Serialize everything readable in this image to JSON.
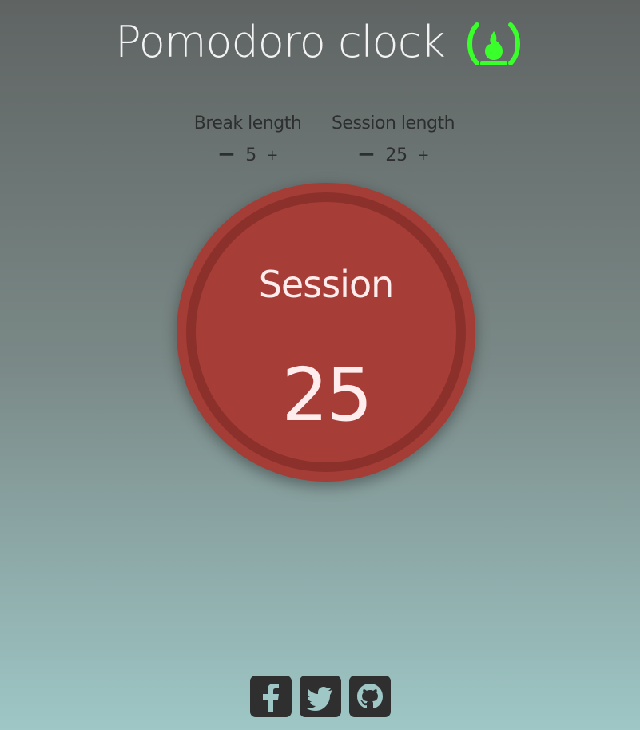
{
  "title": {
    "text": "Pomodoro clock",
    "logo_icon": "fire-icon",
    "logo_color": "#39ff2b"
  },
  "settings": {
    "break": {
      "label": "Break length",
      "minus": "−",
      "value": "5",
      "plus": "+"
    },
    "session": {
      "label": "Session length",
      "minus": "−",
      "value": "25",
      "plus": "+"
    }
  },
  "clock": {
    "label": "Session",
    "time": "25",
    "accent": "#a33d36",
    "ring": "#8c302c"
  },
  "social": {
    "icons": [
      "facebook-icon",
      "twitter-icon",
      "github-icon"
    ]
  }
}
